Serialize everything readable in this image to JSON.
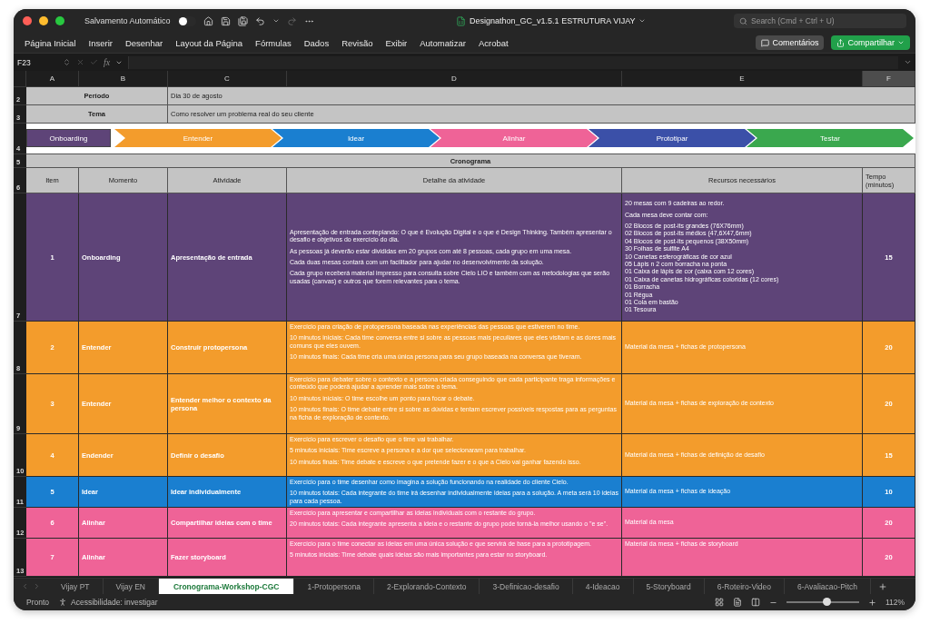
{
  "window": {
    "autosave_label": "Salvamento Automático",
    "autosave_on": false,
    "title": "Designathon_GC_v1.5.1 ESTRUTURA VIJAY",
    "search": {
      "placeholder": "Search (Cmd + Ctrl + U)"
    }
  },
  "ribbon": {
    "tabs": [
      "Página Inicial",
      "Inserir",
      "Desenhar",
      "Layout da Página",
      "Fórmulas",
      "Dados",
      "Revisão",
      "Exibir",
      "Automatizar",
      "Acrobat"
    ],
    "comments": "Comentários",
    "share": "Compartilhar"
  },
  "formula_bar": {
    "cell_ref": "F23",
    "function_label": "fx"
  },
  "columns": [
    {
      "label": "A",
      "selected": false
    },
    {
      "label": "B",
      "selected": false
    },
    {
      "label": "C",
      "selected": false
    },
    {
      "label": "D",
      "selected": false
    },
    {
      "label": "E",
      "selected": false
    },
    {
      "label": "F",
      "selected": true
    }
  ],
  "sheet": {
    "info_rows": [
      {
        "row": "2",
        "label": "Período",
        "value": "Dia 30 de agosto"
      },
      {
        "row": "3",
        "label": "Tema",
        "value": "Como resolver um problema real do seu cliente"
      }
    ],
    "phase_row": "4",
    "phases": [
      {
        "kind": "box",
        "label": "Onboarding",
        "color": "#5e4478"
      },
      {
        "kind": "arrow",
        "label": "Entender",
        "color": "#f39c2c"
      },
      {
        "kind": "arrow",
        "label": "Idear",
        "color": "#1a7fd0"
      },
      {
        "kind": "arrow",
        "label": "Alinhar",
        "color": "#ef6397"
      },
      {
        "kind": "arrow",
        "label": "Prototipar",
        "color": "#3b50a8"
      },
      {
        "kind": "arrow",
        "label": "Testar",
        "color": "#3aa84e"
      }
    ],
    "title_row": {
      "row": "5",
      "title": "Cronograma"
    },
    "header_row": {
      "row": "6",
      "cells": [
        "Item",
        "Momento",
        "Atividade",
        "Detalhe da atividade",
        "Recursos necessários",
        "Tempo (minutos)"
      ]
    },
    "rows": [
      {
        "row": "7",
        "item": "1",
        "moment": "Onboarding",
        "activity": "Apresentação de entrada",
        "color": "#5e4478",
        "detail": [
          "Apresentação de entrada conteplando: O que é Evolução Digital e o que é Design Thinking. Também apresentar o desafio e objetivos do exercício do dia.",
          "As pessoas já deverão estar divididas em 20 grupos com até 8 pessoas, cada grupo em uma mesa.",
          "Cada duas mesas contará com um facilitador para ajudar no desenvolvimento da solução.",
          "Cada grupo receberá material impresso para consulta sobre Cielo LIO e também com as metodologias que serão usadas (canvas) e outros que forem relevantes para o tema."
        ],
        "resources": [
          "20 mesas com 9 cadeiras ao redor.",
          "Cada mesa deve contar com:",
          "02 Blocos de post-its grandes (76X76mm)\n02 Blocos de post-its médios (47,6X47,6mm)\n04 Blocos de post-its pequenos (38X50mm)\n30 Folhas de sulfite A4\n10 Canetas esferográficas de cor azul\n05 Lápis n 2 com borracha na ponta\n01 Caixa de lápis de cor (caixa com 12 cores)\n01 Caixa de canetas hidrográficas coloridas (12 cores)\n01 Borracha\n01 Régua\n01 Cola em bastão\n01 Tesoura"
        ],
        "time": "15"
      },
      {
        "row": "8",
        "item": "2",
        "moment": "Entender",
        "activity": "Construir protopersona",
        "color": "#f39c2c",
        "detail": [
          "Exercício para criação de protopersona baseada nas experiências das pessoas que estiverem no time.",
          "10 minutos iniciais: Cada time conversa entre si sobre as pessoas mais peculiares que eles visitam e as dores mais comuns que eles ouvem.",
          "10 minutos finais: Cada time cria uma única persona para seu grupo baseada na conversa que tiveram."
        ],
        "resources": [
          "Material da mesa + fichas de protopersona"
        ],
        "time": "20"
      },
      {
        "row": "9",
        "item": "3",
        "moment": "Entender",
        "activity": "Entender melhor o contexto da persona",
        "color": "#f39c2c",
        "detail": [
          "Exercício para debater sobre o contexto e a persona criada conseguindo que cada participante traga informações e conteúdo que poderá ajudar a aprender mais sobre o tema.",
          "10 minutos iniciais: O time escolhe um ponto para focar o debate.",
          "10 minutos finais: O time debate entre si sobre as dúvidas e tentam escrever possíveis respostas para as perguntas na ficha de exploração de contexto."
        ],
        "resources": [
          "Material da mesa + fichas de exploração de contexto"
        ],
        "time": "20"
      },
      {
        "row": "10",
        "item": "4",
        "moment": "Endender",
        "activity": "Definir o desafio",
        "color": "#f39c2c",
        "detail": [
          "Exercício para escrever o desafio que o time vai trabalhar.",
          "5 minutos iniciais: Time escreve a persona e a dor que selecionaram para trabalhar.",
          "10 minutos finais: Time debate e escreve o que pretende fazer e o que a Cielo vai ganhar fazendo isso."
        ],
        "resources": [
          "Material da mesa + fichas de definição de desafio"
        ],
        "time": "15"
      },
      {
        "row": "11",
        "item": "5",
        "moment": "Idear",
        "activity": "Idear individualmente",
        "color": "#1a7fd0",
        "detail": [
          "Exercício para o time desenhar como imagina a solução funcionando na realidade do cliente Cielo.",
          "10 minutos totais: Cada integrante do time irá desenhar individualmente ideias para a solução. A meta será 10 ideias para cada pessoa."
        ],
        "resources": [
          "Material da mesa + fichas de ideação"
        ],
        "time": "10"
      },
      {
        "row": "12",
        "item": "6",
        "moment": "Alinhar",
        "activity": "Compartilhar ideias com o time",
        "color": "#ef6397",
        "detail": [
          "Exercício para apresentar e compartilhar as ideias individuais com o restante do grupo.",
          "20 minutos totais: Cada integrante apresenta a ideia e o restante do grupo pode torná-la melhor usando o \"e se\"."
        ],
        "resources": [
          "Material da mesa"
        ],
        "time": "20"
      },
      {
        "row": "13",
        "item": "7",
        "moment": "Alinhar",
        "activity": "Fazer storyboard",
        "color": "#ef6397",
        "detail": [
          "Exercício para o time conectar as ideias em uma única solução e que servirá de base para a prototipagem.",
          "5 minutos iniciais: Time debate quais ideias são mais importantes para estar no storyboard."
        ],
        "resources": [
          "Material da mesa + fichas de storyboard"
        ],
        "time": "20"
      }
    ]
  },
  "sheet_tabs": [
    {
      "label": "Vijay PT",
      "selected": false
    },
    {
      "label": "Vijay EN",
      "selected": false
    },
    {
      "label": "Cronograma-Workshop-CGC",
      "selected": true
    },
    {
      "label": "1-Protopersona",
      "selected": false
    },
    {
      "label": "2-Explorando-Contexto",
      "selected": false
    },
    {
      "label": "3-Definicao-desafio",
      "selected": false
    },
    {
      "label": "4-Ideacao",
      "selected": false
    },
    {
      "label": "5-Storyboard",
      "selected": false
    },
    {
      "label": "6-Roteiro-Video",
      "selected": false
    },
    {
      "label": "6-Avaliacao-Pitch",
      "selected": false
    }
  ],
  "status_bar": {
    "status": "Pronto",
    "accessibility": "Acessibilidade: investigar",
    "zoom": "112%",
    "zoom_slider": {
      "level": 0.55
    }
  }
}
